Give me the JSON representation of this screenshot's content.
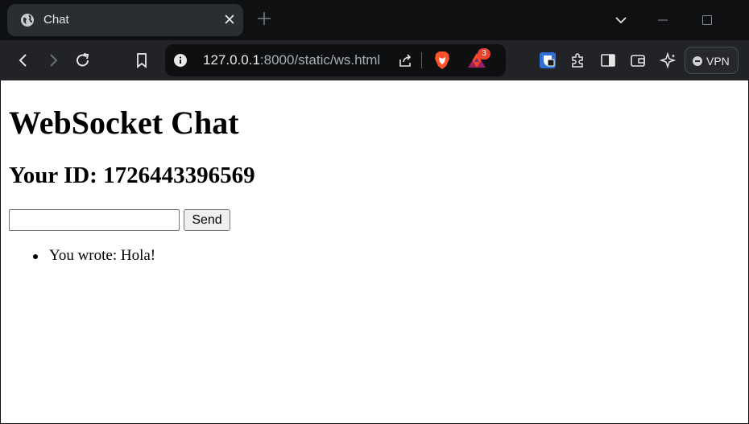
{
  "browser": {
    "tab": {
      "title": "Chat",
      "icon": "globe-icon"
    },
    "address": {
      "host": "127.0.0.1",
      "rest": ":8000/static/ws.html"
    },
    "rewards_badge": "3",
    "vpn_label": "VPN"
  },
  "page": {
    "heading": "WebSocket Chat",
    "id_line": "Your ID: 1726443396569",
    "message_input": {
      "value": "",
      "placeholder": ""
    },
    "send_label": "Send",
    "messages": [
      "You wrote: Hola!"
    ]
  }
}
